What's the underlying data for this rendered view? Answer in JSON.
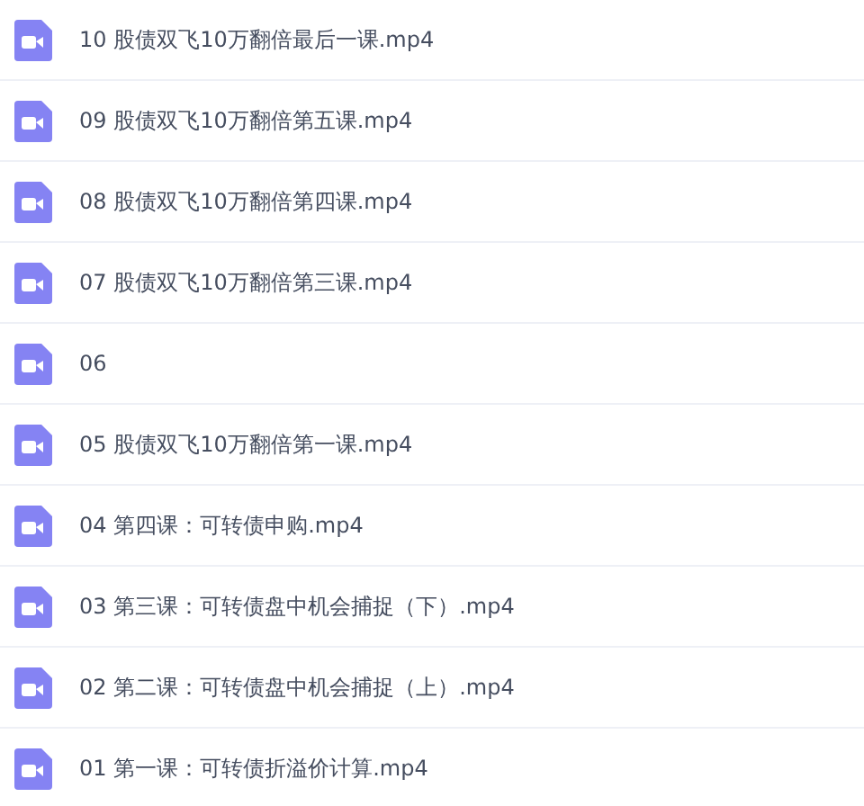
{
  "files": [
    {
      "name": "10 股债双飞10万翻倍最后一课.mp4"
    },
    {
      "name": "09 股债双飞10万翻倍第五课.mp4"
    },
    {
      "name": "08 股债双飞10万翻倍第四课.mp4"
    },
    {
      "name": "07 股债双飞10万翻倍第三课.mp4"
    },
    {
      "name": "06"
    },
    {
      "name": "05 股债双飞10万翻倍第一课.mp4"
    },
    {
      "name": "04 第四课：可转债申购.mp4"
    },
    {
      "name": "03 第三课：可转债盘中机会捕捉（下）.mp4"
    },
    {
      "name": "02 第二课：可转债盘中机会捕捉（上）.mp4"
    },
    {
      "name": "01 第一课：可转债折溢价计算.mp4"
    }
  ]
}
